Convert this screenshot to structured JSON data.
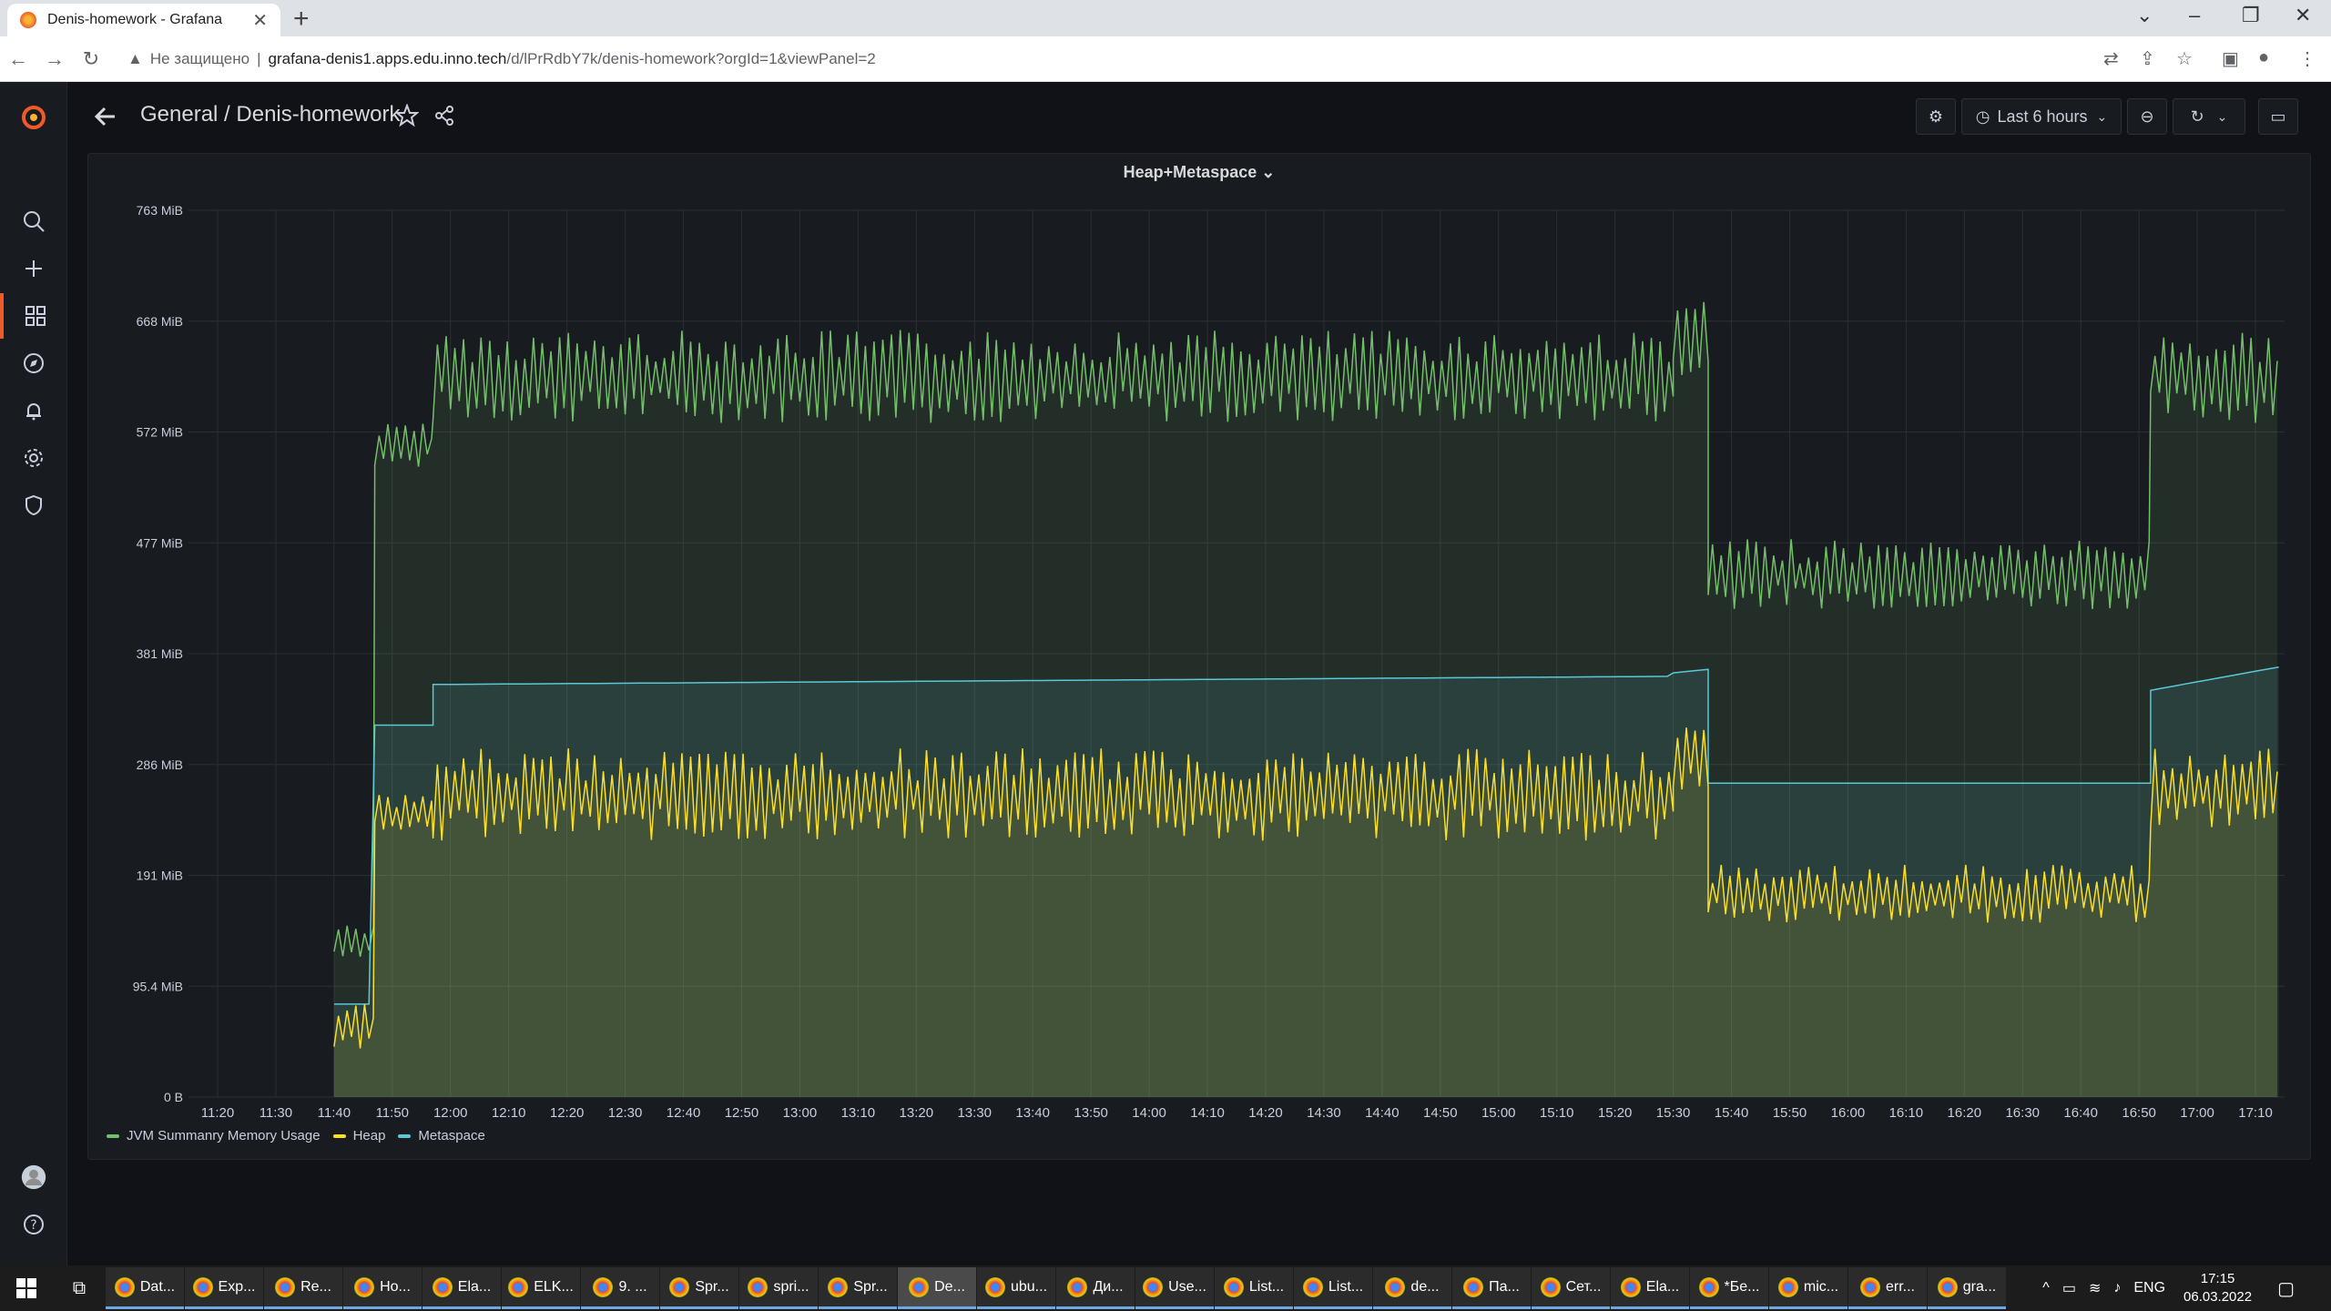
{
  "browser": {
    "tab_title": "Denis-homework - Grafana",
    "url_warning": "Не защищено",
    "url_host": "grafana-denis1.apps.edu.inno.tech",
    "url_path": "/d/lPrRdbY7k/denis-homework?orgId=1&viewPanel=2"
  },
  "header": {
    "breadcrumb": "General  / Denis-homework",
    "time_range": "Last 6 hours"
  },
  "panel": {
    "title": "Heap+Metaspace ⌄"
  },
  "colors": {
    "jvm": "#73bf69",
    "heap": "#fade2a",
    "metaspace": "#5ac8d8"
  },
  "chart_data": {
    "type": "area",
    "title": "Heap+Metaspace",
    "y_ticks": [
      "0 B",
      "95.4 MiB",
      "191 MiB",
      "286 MiB",
      "381 MiB",
      "477 MiB",
      "572 MiB",
      "668 MiB",
      "763 MiB"
    ],
    "ylim": [
      0,
      763
    ],
    "x_ticks": [
      "11:20",
      "11:30",
      "11:40",
      "11:50",
      "12:00",
      "12:10",
      "12:20",
      "12:30",
      "12:40",
      "12:50",
      "13:00",
      "13:10",
      "13:20",
      "13:30",
      "13:40",
      "13:50",
      "14:00",
      "14:10",
      "14:20",
      "14:30",
      "14:40",
      "14:50",
      "15:00",
      "15:10",
      "15:20",
      "15:30",
      "15:40",
      "15:50",
      "16:00",
      "16:10",
      "16:20",
      "16:30",
      "16:40",
      "16:50",
      "17:00",
      "17:10"
    ],
    "xlim": [
      "11:15",
      "17:15"
    ],
    "legend_position": "bottom-left",
    "grid": true,
    "series": [
      {
        "name": "JVM Summanry Memory Usage",
        "segments": [
          {
            "from": "11:40",
            "to": "11:47",
            "low": 120,
            "high": 150
          },
          {
            "from": "11:47",
            "to": "11:57",
            "low": 540,
            "high": 580
          },
          {
            "from": "11:57",
            "to": "15:30",
            "low": 580,
            "high": 660
          },
          {
            "from": "15:30",
            "to": "15:36",
            "low": 620,
            "high": 690
          },
          {
            "from": "15:36",
            "to": "16:52",
            "low": 420,
            "high": 480
          },
          {
            "from": "16:52",
            "to": "17:14",
            "low": 580,
            "high": 660
          }
        ]
      },
      {
        "name": "Heap",
        "segments": [
          {
            "from": "11:40",
            "to": "11:47",
            "low": 40,
            "high": 80
          },
          {
            "from": "11:47",
            "to": "11:57",
            "low": 230,
            "high": 260
          },
          {
            "from": "11:57",
            "to": "15:30",
            "low": 220,
            "high": 300
          },
          {
            "from": "15:30",
            "to": "15:36",
            "low": 260,
            "high": 320
          },
          {
            "from": "15:36",
            "to": "16:52",
            "low": 150,
            "high": 200
          },
          {
            "from": "16:52",
            "to": "17:14",
            "low": 230,
            "high": 300
          }
        ]
      },
      {
        "name": "Metaspace",
        "segments": [
          {
            "from": "11:40",
            "to": "11:47",
            "low": 80,
            "high": 80
          },
          {
            "from": "11:47",
            "to": "11:57",
            "low": 320,
            "high": 320
          },
          {
            "from": "11:57",
            "to": "15:30",
            "low": 355,
            "high": 362
          },
          {
            "from": "15:30",
            "to": "15:36",
            "low": 365,
            "high": 368
          },
          {
            "from": "15:36",
            "to": "16:52",
            "low": 270,
            "high": 270
          },
          {
            "from": "16:52",
            "to": "17:14",
            "low": 350,
            "high": 370
          }
        ]
      }
    ]
  },
  "taskbar": {
    "items": [
      "Dat...",
      "Exp...",
      "Re...",
      "Ho...",
      "Ela...",
      "ELK...",
      "9. ...",
      "Spr...",
      "spri...",
      "Spr...",
      "De...",
      "ubu...",
      "Ди...",
      "Use...",
      "List...",
      "List...",
      "de...",
      "Па...",
      "Сет...",
      "Ela...",
      "*Бе...",
      "mic...",
      "err...",
      "gra..."
    ],
    "lang": "ENG",
    "time": "17:15",
    "date": "06.03.2022"
  }
}
